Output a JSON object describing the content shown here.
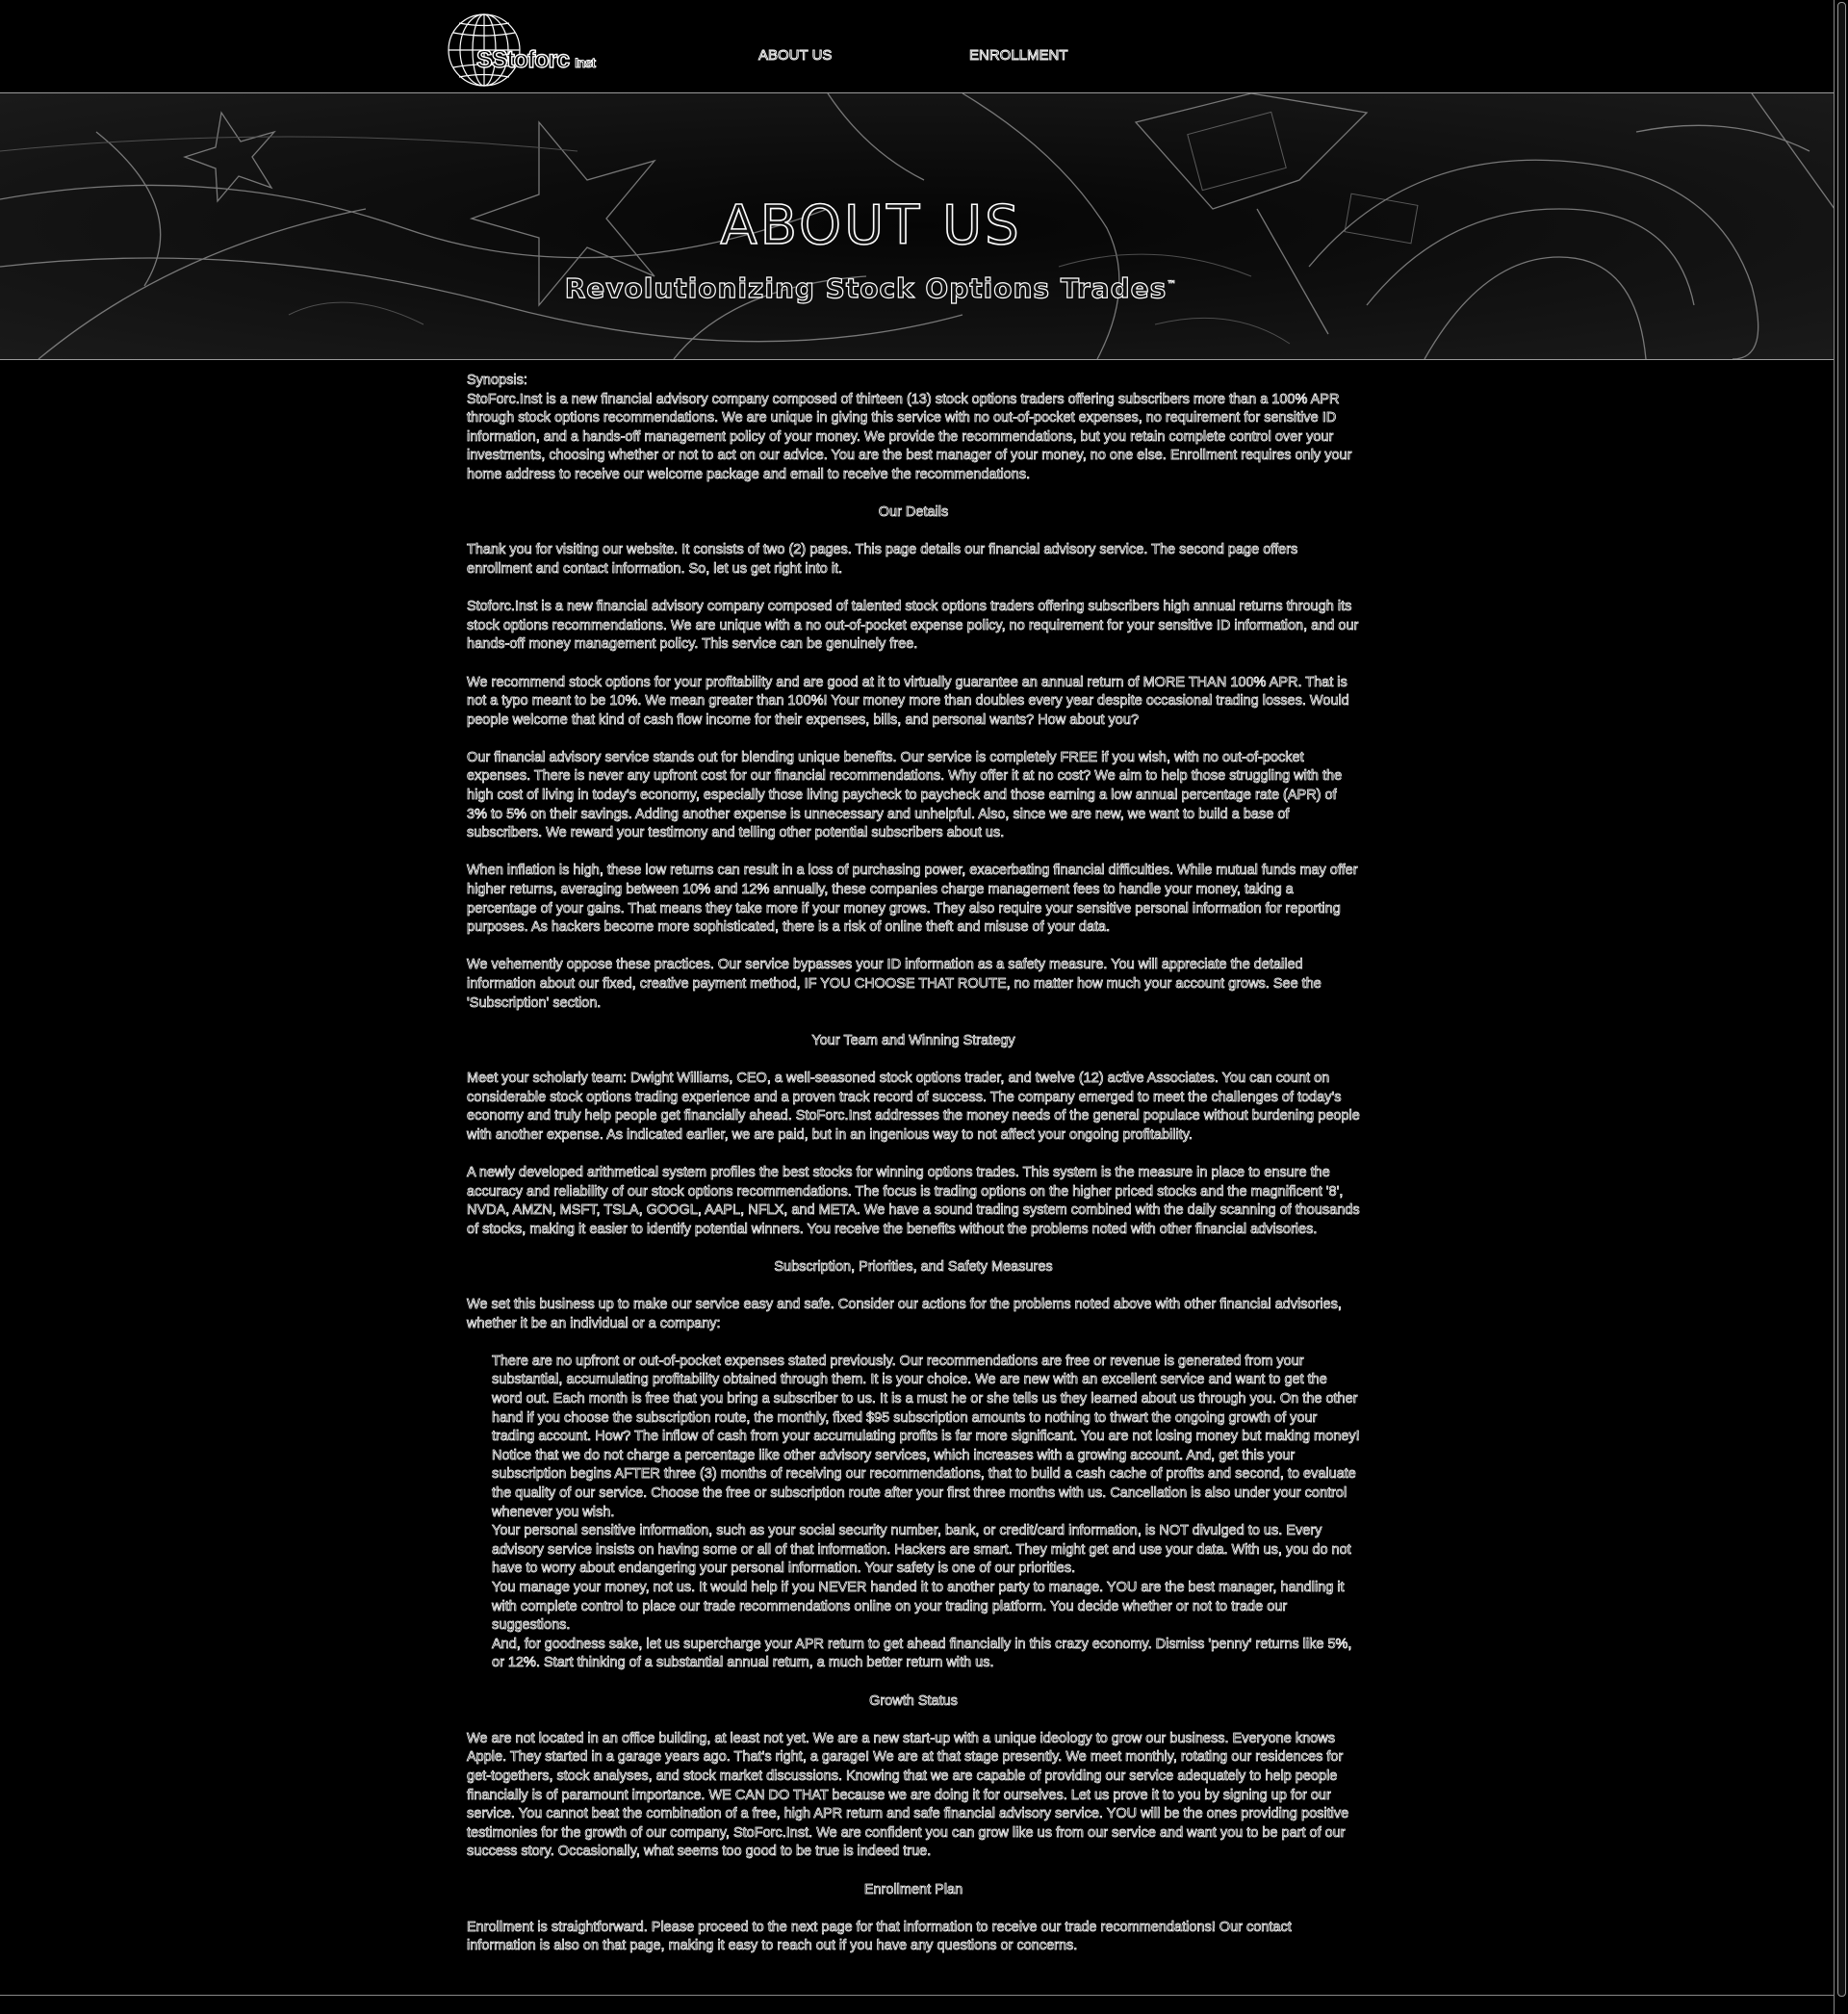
{
  "header": {
    "logo_text": "SStoforc",
    "logo_suffix": "Inst",
    "nav": [
      "ABOUT US",
      "ENROLLMENT"
    ]
  },
  "hero": {
    "title": "ABOUT US",
    "subtitle": "Revolutionizing Stock Options Trades",
    "trademark": "™"
  },
  "content": {
    "synopsis_label": "Synopsis:",
    "synopsis": "StoForc.Inst is a new financial advisory company composed of thirteen (13) stock options traders offering subscribers more than a 100% APR through stock options recommendations.  We are unique in giving this service with no out-of-pocket expenses, no requirement for sensitive ID information, and a hands-off management policy of your money. We provide the recommendations, but you retain complete control over your investments, choosing whether or not to act on our advice. You are the best manager of your money, no one else. Enrollment requires only your home address to receive our welcome package and email to receive the recommendations.",
    "details_heading": "Our Details",
    "details_paragraphs": [
      "Thank you for visiting our website. It consists of two (2) pages. This page details our financial advisory service. The second page offers enrollment and contact information. So, let us get right into it.",
      "Stoforc.Inst is a new financial advisory company composed of talented stock options traders offering subscribers high annual returns through its stock options recommendations.  We are unique with a no out-of-pocket expense policy, no requirement for your sensitive ID information, and our hands-off money management policy. This service can be genuinely free.",
      "We recommend stock options for your profitability and are good at it to virtually guarantee an annual return of MORE THAN 100% APR. That is not a typo meant to be 10%. We mean greater than 100%! Your money more than doubles every year despite occasional trading losses. Would people welcome that kind of cash flow income for their expenses, bills, and personal wants? How about you?",
      "Our financial advisory service stands out for blending unique benefits. Our service is completely FREE if you wish, with no out-of-pocket expenses. There is never any upfront cost for our financial recommendations. Why offer it at no cost? We aim to help those struggling with the high cost of living in today's economy, especially those living paycheck to paycheck and those earning a low annual percentage rate (APR) of 3% to 5% on their savings. Adding another expense is unnecessary and unhelpful. Also, since we are new, we want to build a base of subscribers. We reward your testimony and telling other potential subscribers about us.",
      "When inflation is high, these low returns can result in a loss of purchasing power, exacerbating financial difficulties. While mutual funds may offer higher returns, averaging between 10% and 12% annually, these companies charge management fees to handle your money, taking a percentage of your gains. That means they take more if your money grows. They also require your sensitive personal information for reporting purposes. As hackers become more sophisticated, there is a risk of online theft and misuse of your data.",
      "We vehemently oppose these practices. Our service bypasses your ID information as a safety measure. You will appreciate the detailed information about our fixed, creative payment method, IF YOU CHOOSE THAT ROUTE, no matter how much your account grows. See the 'Subscription' section."
    ],
    "team_heading": "Your Team and Winning Strategy",
    "team_paragraphs": [
      "Meet your scholarly team: Dwight Williams, CEO, a well-seasoned stock options trader, and twelve (12) active Associates. You can count on considerable stock options trading experience and a proven track record of success. The company emerged to meet the challenges of today's economy and truly help people get financially ahead. StoForc.Inst addresses the money needs of the general populace without burdening people with another expense. As indicated earlier, we are paid, but in an ingenious way to not affect your ongoing profitability.",
      "A newly developed arithmetical system profiles the best stocks for winning options trades. This system is the measure in place to ensure the accuracy and reliability of our stock options recommendations. The focus is trading options on the higher priced stocks and the magnificent '8', NVDA, AMZN, MSFT, TSLA, GOOGL, AAPL, NFLX, and META. We have a sound trading system combined with the daily scanning of thousands of stocks, making it easier to identify potential winners. You receive the benefits without the problems noted with other financial advisories."
    ],
    "subscription_heading": "Subscription, Priorities, and Safety Measures",
    "subscription_intro": "We set this business up to make our service easy and safe. Consider our actions for the problems noted above with other financial advisories, whether it be an individual or a company:",
    "subscription_points": [
      "There are no upfront or out-of-pocket expenses stated previously. Our  recommendations are free or revenue is generated from your substantial, accumulating profitability obtained through them. It is your choice. We are new with an excellent service and want to get the word out. Each month is free that you bring a subscriber to us. It is a must he or she tells us they learned about us through you. On the other hand if you choose the subscription route, the monthly, fixed $95 subscription amounts to nothing to thwart the ongoing growth of your trading account. How? The inflow of cash from your accumulating profits is far more significant. You are not losing money but making money! Notice that we do not charge a percentage like other advisory services, which increases with a growing account. And, get this your subscription begins AFTER three (3) months of receiving our recommendations, that to build a cash cache of profits and second, to evaluate the quality of our service. Choose the free or subscription route after your first three months with us. Cancellation is also under your control whenever you wish.",
      "Your personal sensitive information, such as your social security number, bank, or credit/card information, is NOT divulged to us. Every advisory service insists on having some or all of that information. Hackers are smart. They might get and use your data. With us, you do not have to worry about endangering your personal information. Your safety is one of our priorities.",
      "You manage your money, not us. It would help if you NEVER handed it to another party to manage. YOU are the best manager, handling it with complete control to place our trade recommendations online on your trading platform. You decide whether or not to trade our suggestions.",
      "And, for goodness sake, let us supercharge your APR return to get ahead financially in this crazy economy.  Dismiss 'penny' returns like 5%, or 12%. Start thinking of a substantial annual return, a much better return with us."
    ],
    "growth_heading": "Growth Status",
    "growth_paragraph": "We are not located in an office building, at least not yet. We are a new start-up with a unique ideology to grow our business. Everyone knows Apple. They started in a garage years ago. That's right, a garage! We are at that stage presently. We meet monthly, rotating our residences for get-togethers, stock analyses, and stock market discussions. Knowing that we are capable of providing our service adequately to help people financially is of paramount importance.  WE CAN DO THAT because we are doing it for ourselves. Let us prove it to you by signing up for our service. You cannot beat the combination of a free, high APR return and safe financial advisory service. YOU will be the ones providing positive testimonies for the growth of our company, StoForc.Inst. We are confident you can grow like us from our service and want you to be part of our success story. Occasionally, what seems too good to be true is indeed true.",
    "enrollment_heading": "Enrollment Plan",
    "enrollment_paragraph": "Enrollment is straightforward. Please proceed to the next page for that information to receive our trade recommendations! Our contact information is also on that page, making it easy to reach out if you have any questions or concerns."
  }
}
